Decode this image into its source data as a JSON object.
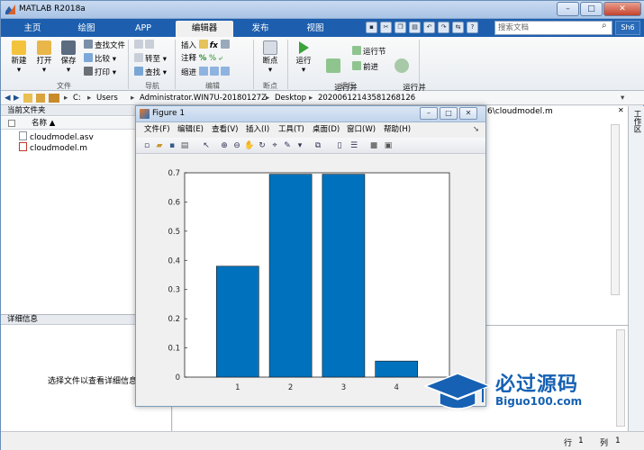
{
  "titlebar": {
    "title": "MATLAB R2018a",
    "minimize": "–",
    "maximize": "□",
    "close": "✕"
  },
  "tabs": [
    "主页",
    "绘图",
    "APP",
    "编辑器",
    "发布",
    "视图"
  ],
  "search": {
    "placeholder": "搜索文档"
  },
  "help_label": "Sh6",
  "ribbon": {
    "file_group": {
      "new": "新建",
      "open": "打开",
      "save": "保存",
      "find_files": "查找文件",
      "compare": "比较",
      "print": "打印",
      "label": "文件"
    },
    "nav_group": {
      "goto": "转至",
      "find": "查找",
      "label": "导航"
    },
    "edit_group": {
      "insert": "插入",
      "comment": "注释",
      "indent": "缩进",
      "label": "编辑"
    },
    "breakpoint_group": {
      "breakpoints": "断点",
      "label": "断点"
    },
    "run_group": {
      "run": "运行",
      "run_advance": "运行并\n前进",
      "run_section": "运行节",
      "advance": "前进",
      "run_time": "运行并\n计时",
      "label": "运行"
    }
  },
  "path": {
    "segments": [
      "C:",
      "Users",
      "Administrator.WIN7U-20180127Z",
      "Desktop",
      "20200612143581268126"
    ]
  },
  "folder_panel": {
    "title": "当前文件夹",
    "column": "名称 ▲",
    "files": [
      "cloudmodel.asv",
      "cloudmodel.m"
    ]
  },
  "details_panel": {
    "title": "详细信息",
    "hint": "选择文件以查看详细信息"
  },
  "editor": {
    "tab": "6\\cloudmodel.m"
  },
  "workspace_label": "工作区",
  "statusbar": {
    "row_label": "行",
    "row": "1",
    "col_label": "列",
    "col": "1"
  },
  "figure": {
    "title": "Figure 1",
    "menus": [
      "文件(F)",
      "编辑(E)",
      "查看(V)",
      "插入(I)",
      "工具(T)",
      "桌面(D)",
      "窗口(W)",
      "帮助(H)"
    ]
  },
  "chart_data": {
    "type": "bar",
    "categories": [
      "1",
      "2",
      "3",
      "4"
    ],
    "values": [
      0.38,
      0.695,
      0.695,
      0.055
    ],
    "xlim": [
      0,
      5
    ],
    "ylim": [
      0,
      0.7
    ],
    "yticks": [
      "0",
      "0.1",
      "0.2",
      "0.3",
      "0.4",
      "0.5",
      "0.6",
      "0.7"
    ],
    "bar_color": "#0072bd",
    "title": "",
    "xlabel": "",
    "ylabel": ""
  },
  "watermark": {
    "cn": "必过源码",
    "en": "Biguo100.com"
  }
}
